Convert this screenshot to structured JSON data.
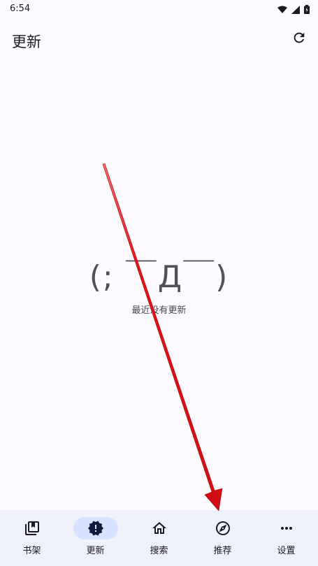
{
  "status_bar": {
    "time": "6:54"
  },
  "header": {
    "title": "更新"
  },
  "empty_state": {
    "kaomoji": "(; ￣Д￣)",
    "message": "最近没有更新"
  },
  "nav": {
    "items": [
      {
        "label": "书架",
        "icon": "library-icon",
        "active": false
      },
      {
        "label": "更新",
        "icon": "new-releases-icon",
        "active": true
      },
      {
        "label": "搜索",
        "icon": "home-icon",
        "active": false
      },
      {
        "label": "推荐",
        "icon": "compass-icon",
        "active": false
      },
      {
        "label": "设置",
        "icon": "more-horiz-icon",
        "active": false
      }
    ]
  },
  "colors": {
    "background": "#fdfbff",
    "nav_background": "#eef0fb",
    "active_pill": "#d8e2ff",
    "annotation_arrow": "#e0141b"
  }
}
